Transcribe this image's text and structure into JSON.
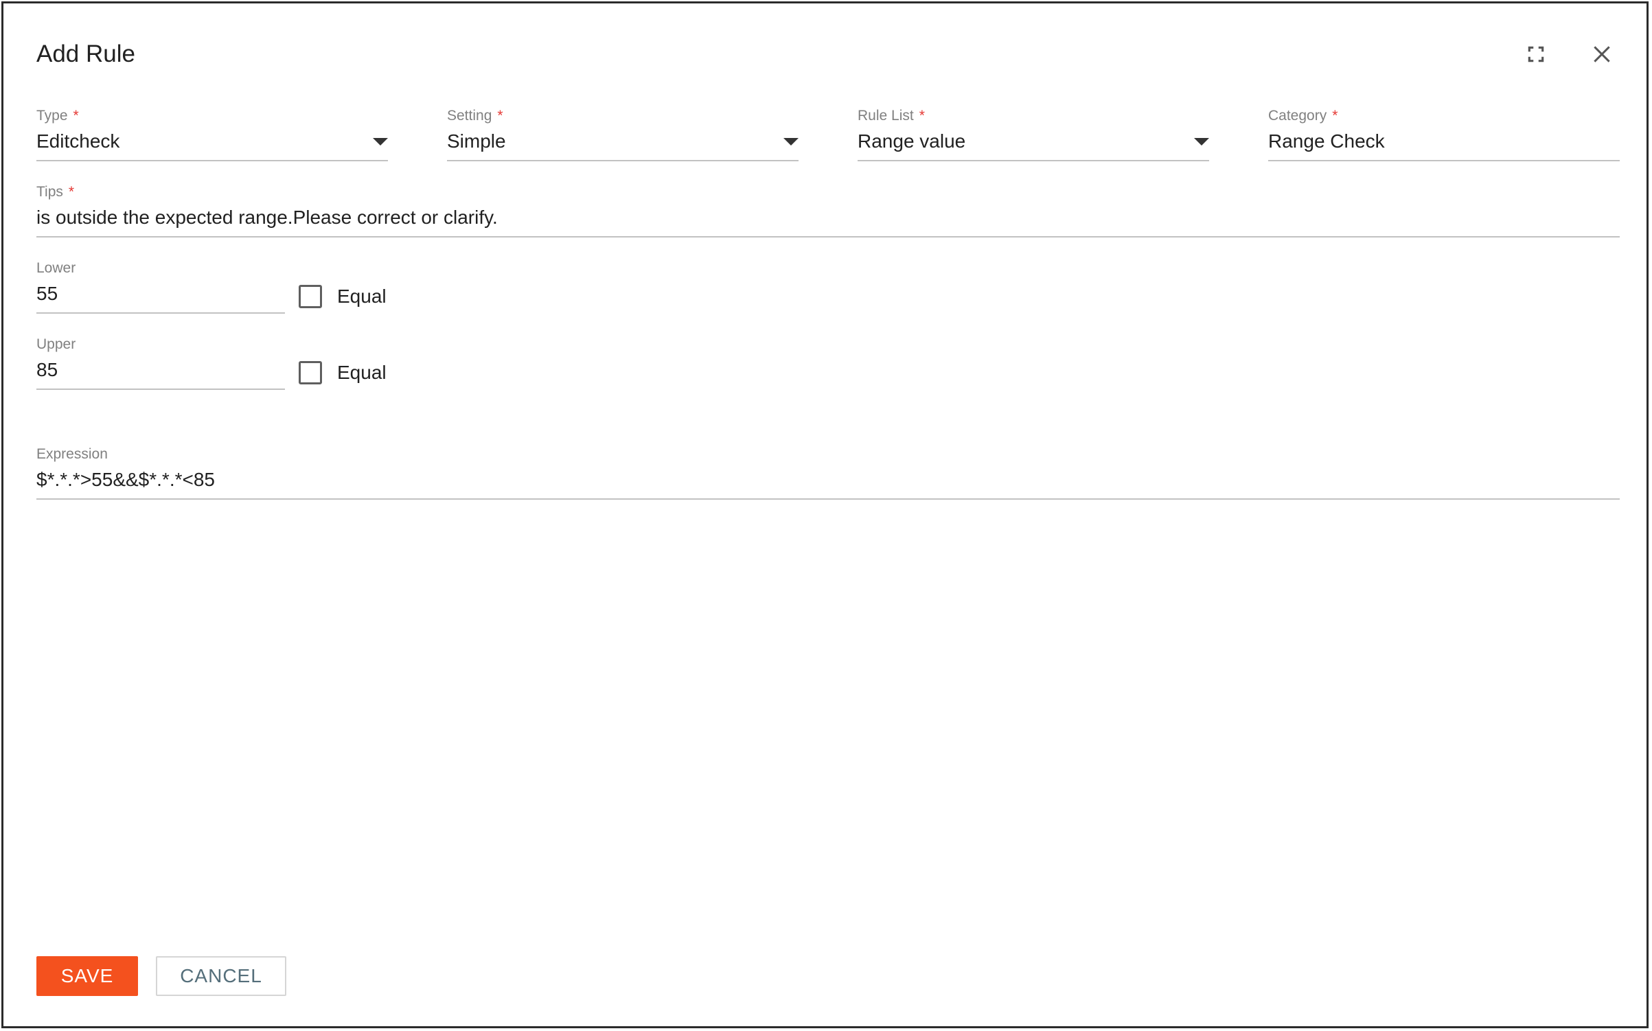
{
  "dialog": {
    "title": "Add Rule"
  },
  "fields": {
    "type": {
      "label": "Type",
      "required": "*",
      "value": "Editcheck"
    },
    "setting": {
      "label": "Setting",
      "required": "*",
      "value": "Simple"
    },
    "rule_list": {
      "label": "Rule List",
      "required": "*",
      "value": "Range value"
    },
    "category": {
      "label": "Category",
      "required": "*",
      "value": "Range Check"
    },
    "tips": {
      "label": "Tips",
      "required": "*",
      "value": "is outside the expected range.Please correct or clarify."
    },
    "lower": {
      "label": "Lower",
      "value": "55",
      "equal_label": "Equal",
      "equal_checked": false
    },
    "upper": {
      "label": "Upper",
      "value": "85",
      "equal_label": "Equal",
      "equal_checked": false
    },
    "expression": {
      "label": "Expression",
      "value": "$*.*.*>55&&$*.*.*<85"
    }
  },
  "actions": {
    "save_label": "SAVE",
    "cancel_label": "CANCEL"
  },
  "icons": {
    "fullscreen": "fullscreen-icon",
    "close": "close-icon",
    "dropdown": "caret-down-icon",
    "checkbox": "checkbox-unchecked-icon"
  },
  "colors": {
    "primary_button": "#f4511e",
    "required_marker": "#e53935",
    "label": "#808080",
    "underline": "#c2c2c2",
    "cancel_text": "#546e7a"
  }
}
